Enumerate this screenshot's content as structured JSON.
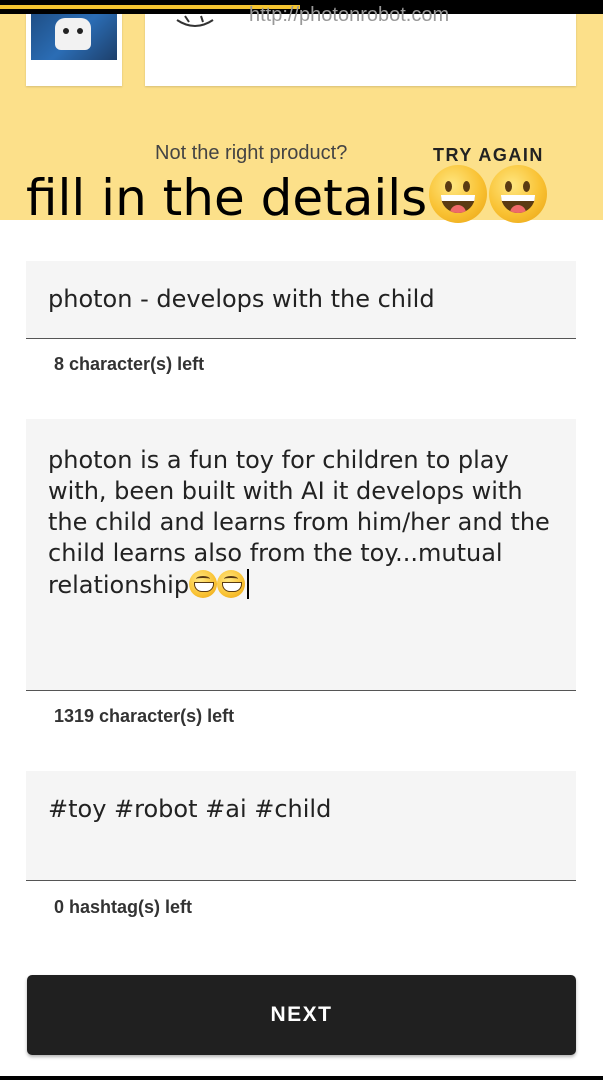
{
  "header": {
    "url": "http://photonrobot.com",
    "not_right_text": "Not the right product?",
    "try_again_label": "TRY AGAIN",
    "overlay_caption": "fill in the details",
    "overlay_emojis": [
      "grinning-face",
      "grinning-face"
    ]
  },
  "form": {
    "title": {
      "value": "photon - develops with the child",
      "helper": "8 character(s) left"
    },
    "description": {
      "value": "photon is a fun toy for children to play with, been built with AI it develops with the child and learns from him/her and the child learns also from the toy...mutual relationship",
      "emojis": [
        "grinning-face-with-smiling-eyes",
        "grinning-face-with-smiling-eyes"
      ],
      "helper": "1319 character(s) left"
    },
    "hashtags": {
      "value": "#toy #robot #ai #child",
      "helper": "0 hashtag(s) left"
    }
  },
  "actions": {
    "next_label": "NEXT"
  },
  "colors": {
    "header_background": "#fce08a",
    "field_background": "#f5f5f5",
    "button_background": "#202020",
    "button_text": "#ffffff"
  }
}
